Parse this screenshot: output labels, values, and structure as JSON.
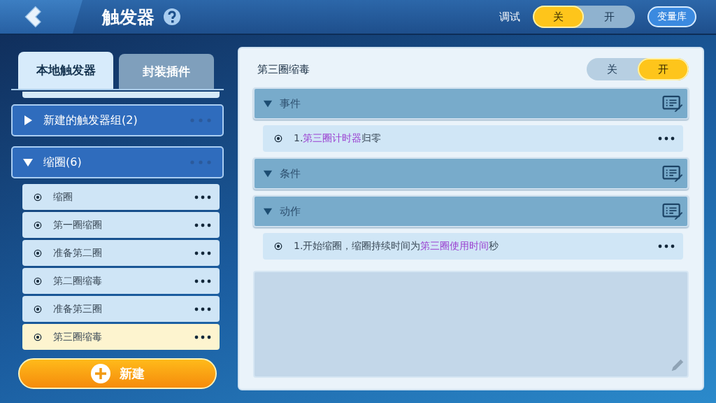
{
  "header": {
    "title": "触发器",
    "debug_label": "调试",
    "debug_toggle": [
      {
        "label": "关",
        "selected": true
      },
      {
        "label": "开",
        "selected": false
      }
    ],
    "variables_button": "变量库"
  },
  "tabs": [
    {
      "label": "本地触发器",
      "selected": true
    },
    {
      "label": "封装插件",
      "selected": false
    }
  ],
  "groups": [
    {
      "name": "新建的触发器组(2)",
      "expanded": false
    },
    {
      "name": "缩圈(6)",
      "expanded": true,
      "items": [
        {
          "name": "缩圈",
          "selected": false
        },
        {
          "name": "第一圈缩圈",
          "selected": false
        },
        {
          "name": "准备第二圈",
          "selected": false
        },
        {
          "name": "第二圈缩毒",
          "selected": false
        },
        {
          "name": "准备第三圈",
          "selected": false
        },
        {
          "name": "第三圈缩毒",
          "selected": true
        }
      ]
    }
  ],
  "new_button": "新建",
  "detail": {
    "title": "第三圈缩毒",
    "toggle": [
      {
        "label": "关",
        "selected": false
      },
      {
        "label": "开",
        "selected": true
      }
    ],
    "sections": [
      {
        "title": "事件",
        "expanded": true,
        "entries": [
          [
            {
              "text": "1.",
              "kind": "plain"
            },
            {
              "text": "第三圈计时器",
              "kind": "variable"
            },
            {
              "text": "归零",
              "kind": "plain"
            }
          ]
        ]
      },
      {
        "title": "条件",
        "expanded": true
      },
      {
        "title": "动作",
        "expanded": true,
        "entries": [
          [
            {
              "text": "1.开始缩圈，缩圈持续时间为",
              "kind": "plain"
            },
            {
              "text": "第三圈使用时间",
              "kind": "variable"
            },
            {
              "text": "秒",
              "kind": "plain"
            }
          ]
        ]
      }
    ]
  }
}
